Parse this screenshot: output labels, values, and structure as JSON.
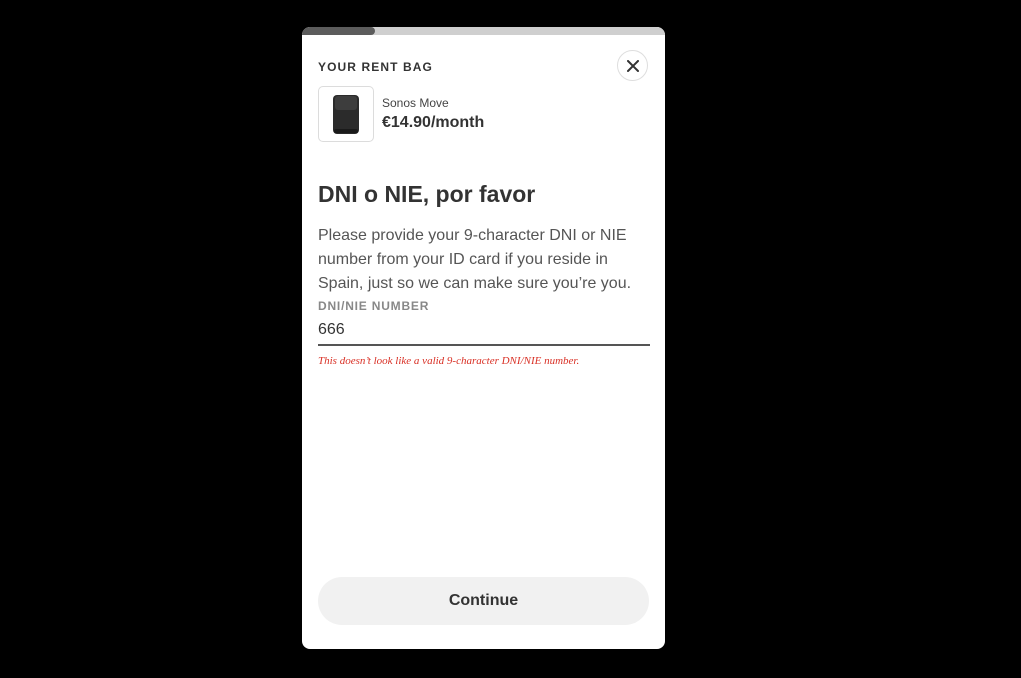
{
  "progress": {
    "fraction": 0.2
  },
  "bag": {
    "title": "YOUR RENT BAG",
    "close_icon": "close-icon"
  },
  "product": {
    "name": "Sonos Move",
    "price": "€14.90/month",
    "image_icon": "speaker-icon"
  },
  "form": {
    "heading": "DNI o NIE, por favor",
    "description": "Please provide your 9-character DNI or NIE number from your ID card if you reside in Spain, just so we can make sure you’re you.",
    "field_label": "DNI/NIE NUMBER",
    "field_value": "666",
    "error": "This doesn’t look like a valid 9-character DNI/NIE number."
  },
  "actions": {
    "continue_label": "Continue"
  },
  "colors": {
    "error": "#d93025",
    "progress_fill": "#5c5c5c",
    "progress_track": "#cfcfcf",
    "button_bg": "#f1f1f1"
  }
}
